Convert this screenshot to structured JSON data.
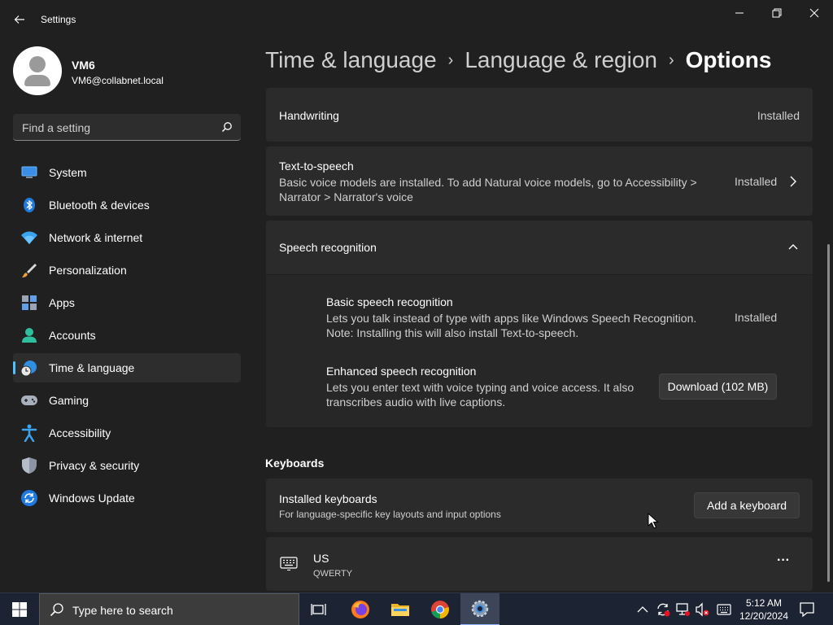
{
  "window": {
    "title": "Settings",
    "minimize_glyph": "─",
    "maximize_glyph": "❐",
    "close_glyph": "✕"
  },
  "profile": {
    "name": "VM6",
    "email": "VM6@collabnet.local"
  },
  "search": {
    "placeholder": "Find a setting"
  },
  "sidebar": {
    "items": [
      {
        "label": "System",
        "icon": "system-icon"
      },
      {
        "label": "Bluetooth & devices",
        "icon": "bluetooth-icon"
      },
      {
        "label": "Network & internet",
        "icon": "wifi-icon"
      },
      {
        "label": "Personalization",
        "icon": "brush-icon"
      },
      {
        "label": "Apps",
        "icon": "apps-icon"
      },
      {
        "label": "Accounts",
        "icon": "accounts-icon"
      },
      {
        "label": "Time & language",
        "icon": "clock-globe-icon",
        "active": true
      },
      {
        "label": "Gaming",
        "icon": "gamepad-icon"
      },
      {
        "label": "Accessibility",
        "icon": "accessibility-icon"
      },
      {
        "label": "Privacy & security",
        "icon": "shield-icon"
      },
      {
        "label": "Windows Update",
        "icon": "update-icon"
      }
    ]
  },
  "breadcrumb": {
    "part1": "Time & language",
    "part2": "Language & region",
    "current": "Options",
    "separator": "›"
  },
  "cards": {
    "handwriting": {
      "title": "Handwriting",
      "status": "Installed"
    },
    "tts": {
      "title": "Text-to-speech",
      "desc_line1": "Basic voice models are installed. To add Natural voice models, go to Accessibility >",
      "desc_line2": "Narrator > Narrator's voice",
      "status": "Installed"
    },
    "speech": {
      "title": "Speech recognition",
      "basic": {
        "title": "Basic speech recognition",
        "desc_line1": "Lets you talk instead of type with apps like Windows Speech Recognition.",
        "desc_line2": "Note: Installing this will also install Text-to-speech.",
        "status": "Installed"
      },
      "enhanced": {
        "title": "Enhanced speech recognition",
        "desc_line1": "Lets you enter text with voice typing and voice access. It also",
        "desc_line2": "transcribes audio with live captions.",
        "button": "Download (102 MB)"
      }
    }
  },
  "keyboards": {
    "section_title": "Keyboards",
    "installed": {
      "title": "Installed keyboards",
      "desc": "For language-specific key layouts and input options",
      "button": "Add a keyboard"
    },
    "us": {
      "title": "US",
      "subtitle": "QWERTY",
      "more": "···"
    }
  },
  "taskbar": {
    "search_placeholder": "Type here to search",
    "time": "5:12 AM",
    "date": "12/20/2024"
  },
  "colors": {
    "accent": "#4cc2ff",
    "background": "#202020",
    "card": "#2b2b2b"
  }
}
